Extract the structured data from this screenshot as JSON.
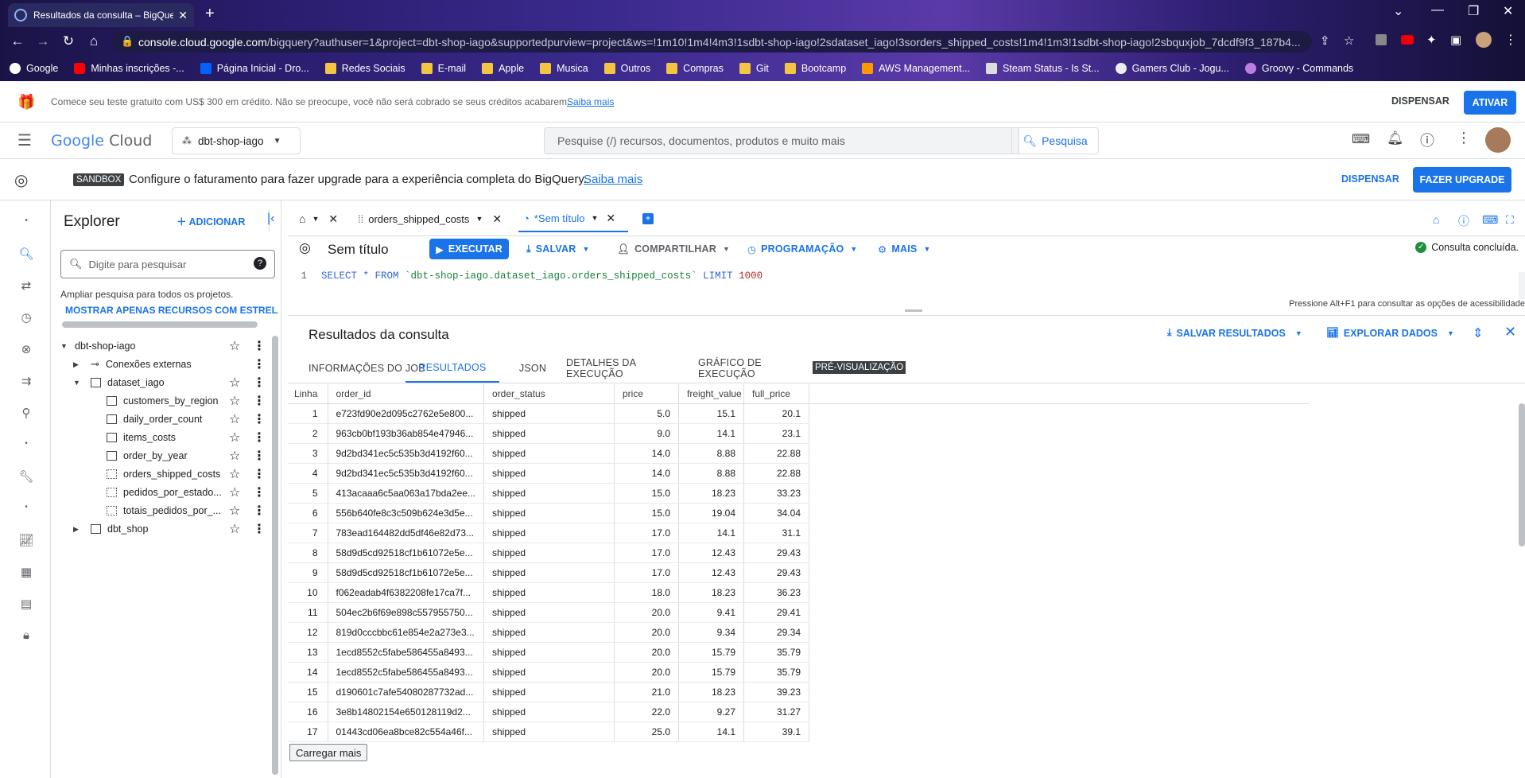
{
  "browser": {
    "tab_title": "Resultados da consulta – BigQuery",
    "url_host": "console.cloud.google.com",
    "url_path": "/bigquery?authuser=1&project=dbt-shop-iago&supportedpurview=project&ws=!1m10!1m4!4m3!1sdbt-shop-iago!2sdataset_iago!3sorders_shipped_costs!1m4!1m3!1sdbt-shop-iago!2sbquxjob_7dcdf9f3_187b4...",
    "bookmarks": [
      {
        "label": "Google",
        "icon": "google-icon"
      },
      {
        "label": "Minhas inscrições -...",
        "icon": "youtube-icon"
      },
      {
        "label": "Página Inicial - Dro...",
        "icon": "dropbox-icon"
      },
      {
        "label": "Redes Sociais",
        "icon": "folder-icon"
      },
      {
        "label": "E-mail",
        "icon": "folder-icon"
      },
      {
        "label": "Apple",
        "icon": "folder-icon"
      },
      {
        "label": "Musica",
        "icon": "folder-icon"
      },
      {
        "label": "Outros",
        "icon": "folder-icon"
      },
      {
        "label": "Compras",
        "icon": "folder-icon"
      },
      {
        "label": "Git",
        "icon": "folder-icon"
      },
      {
        "label": "Bootcamp",
        "icon": "folder-icon"
      },
      {
        "label": "AWS Management...",
        "icon": "aws-icon"
      },
      {
        "label": "Steam Status - Is St...",
        "icon": "steam-icon"
      },
      {
        "label": "Gamers Club - Jogu...",
        "icon": "gamersclub-icon"
      },
      {
        "label": "Groovy - Commands",
        "icon": "groovy-icon"
      }
    ]
  },
  "trial_banner": {
    "text": "Comece seu teste gratuito com US$ 300 em crédito. Não se preocupe, você não será cobrado se seus créditos acabarem.",
    "link": "Saiba mais",
    "dismiss": "DISPENSAR",
    "activate": "ATIVAR"
  },
  "header": {
    "logo_google": "Google",
    "logo_cloud": "Cloud",
    "project": "dbt-shop-iago",
    "search_placeholder": "Pesquise (/) recursos, documentos, produtos e muito mais",
    "search_button": "Pesquisa"
  },
  "sandbox": {
    "badge": "SANDBOX",
    "text": "Configure o faturamento para fazer upgrade para a experiência completa do BigQuery.",
    "link": "Saiba mais",
    "dismiss": "DISPENSAR",
    "upgrade": "FAZER UPGRADE"
  },
  "explorer": {
    "title": "Explorer",
    "add": "ADICIONAR",
    "search_placeholder": "Digite para pesquisar",
    "expand_hint": "Ampliar pesquisa para todos os projetos.",
    "show_starred": "MOSTRAR APENAS RECURSOS COM ESTRELA",
    "tree": [
      {
        "label": "dbt-shop-iago",
        "level": 0,
        "expander": "▼"
      },
      {
        "label": "Conexões externas",
        "level": 1,
        "expander": "▶"
      },
      {
        "label": "dataset_iago",
        "level": 1,
        "expander": "▼"
      },
      {
        "label": "customers_by_region",
        "level": 2,
        "expander": ""
      },
      {
        "label": "daily_order_count",
        "level": 2,
        "expander": ""
      },
      {
        "label": "items_costs",
        "level": 2,
        "expander": ""
      },
      {
        "label": "order_by_year",
        "level": 2,
        "expander": ""
      },
      {
        "label": "orders_shipped_costs",
        "level": 2,
        "expander": ""
      },
      {
        "label": "pedidos_por_estado...",
        "level": 2,
        "expander": ""
      },
      {
        "label": "totais_pedidos_por_...",
        "level": 2,
        "expander": ""
      },
      {
        "label": "dbt_shop",
        "level": 1,
        "expander": "▶"
      }
    ]
  },
  "editor": {
    "tab_1": "orders_shipped_costs",
    "tab_2": "*Sem título",
    "title": "Sem título",
    "run": "EXECUTAR",
    "save": "SALVAR",
    "share": "COMPARTILHAR",
    "schedule": "PROGRAMAÇÃO",
    "more": "MAIS",
    "status": "Consulta concluída.",
    "line_no": "1",
    "sql_select": "SELECT * FROM ",
    "sql_table": "`dbt-shop-iago.dataset_iago.orders_shipped_costs`",
    "sql_limit": " LIMIT ",
    "sql_limit_value": "1000",
    "a11y_hint": "Pressione Alt+F1 para consultar as opções de acessibilidade"
  },
  "results": {
    "title": "Resultados da consulta",
    "save_results": "SALVAR RESULTADOS",
    "explore": "EXPLORAR DADOS",
    "tabs": [
      "INFORMAÇÕES DO JOB",
      "RESULTADOS",
      "JSON",
      "DETALHES DA EXECUÇÃO",
      "GRÁFICO DE EXECUÇÃO"
    ],
    "preview_badge": "PRÉ-VISUALIZAÇÃO",
    "columns": [
      "Linha",
      "order_id",
      "order_status",
      "price",
      "freight_value",
      "full_price"
    ],
    "rows": [
      [
        "1",
        "e723fd90e2d095c2762e5e800...",
        "shipped",
        "5.0",
        "15.1",
        "20.1"
      ],
      [
        "2",
        "963cb0bf193b36ab854e47946...",
        "shipped",
        "9.0",
        "14.1",
        "23.1"
      ],
      [
        "3",
        "9d2bd341ec5c535b3d4192f60...",
        "shipped",
        "14.0",
        "8.88",
        "22.88"
      ],
      [
        "4",
        "9d2bd341ec5c535b3d4192f60...",
        "shipped",
        "14.0",
        "8.88",
        "22.88"
      ],
      [
        "5",
        "413acaaa6c5aa063a17bda2ee...",
        "shipped",
        "15.0",
        "18.23",
        "33.23"
      ],
      [
        "6",
        "556b640fe8c3c509b624e3d5e...",
        "shipped",
        "15.0",
        "19.04",
        "34.04"
      ],
      [
        "7",
        "783ead164482dd5df46e82d73...",
        "shipped",
        "17.0",
        "14.1",
        "31.1"
      ],
      [
        "8",
        "58d9d5cd92518cf1b61072e5e...",
        "shipped",
        "17.0",
        "12.43",
        "29.43"
      ],
      [
        "9",
        "58d9d5cd92518cf1b61072e5e...",
        "shipped",
        "17.0",
        "12.43",
        "29.43"
      ],
      [
        "10",
        "f062eadab4f6382208fe17ca7f...",
        "shipped",
        "18.0",
        "18.23",
        "36.23"
      ],
      [
        "11",
        "504ec2b6f69e898c557955750...",
        "shipped",
        "20.0",
        "9.41",
        "29.41"
      ],
      [
        "12",
        "819d0cccbbc61e854e2a273e3...",
        "shipped",
        "20.0",
        "9.34",
        "29.34"
      ],
      [
        "13",
        "1ecd8552c5fabe586455a8493...",
        "shipped",
        "20.0",
        "15.79",
        "35.79"
      ],
      [
        "14",
        "1ecd8552c5fabe586455a8493...",
        "shipped",
        "20.0",
        "15.79",
        "35.79"
      ],
      [
        "15",
        "d190601c7afe54080287732ad...",
        "shipped",
        "21.0",
        "18.23",
        "39.23"
      ],
      [
        "16",
        "3e8b14802154e650128119d2...",
        "shipped",
        "22.0",
        "9.27",
        "31.27"
      ],
      [
        "17",
        "01443cd06ea8bce82c554a46f...",
        "shipped",
        "25.0",
        "14.1",
        "39.1"
      ]
    ],
    "load_more": "Carregar mais"
  },
  "colors": {
    "accent": "#1a73e8",
    "success": "#1e8e3e",
    "badge_bg": "#3c4043"
  }
}
